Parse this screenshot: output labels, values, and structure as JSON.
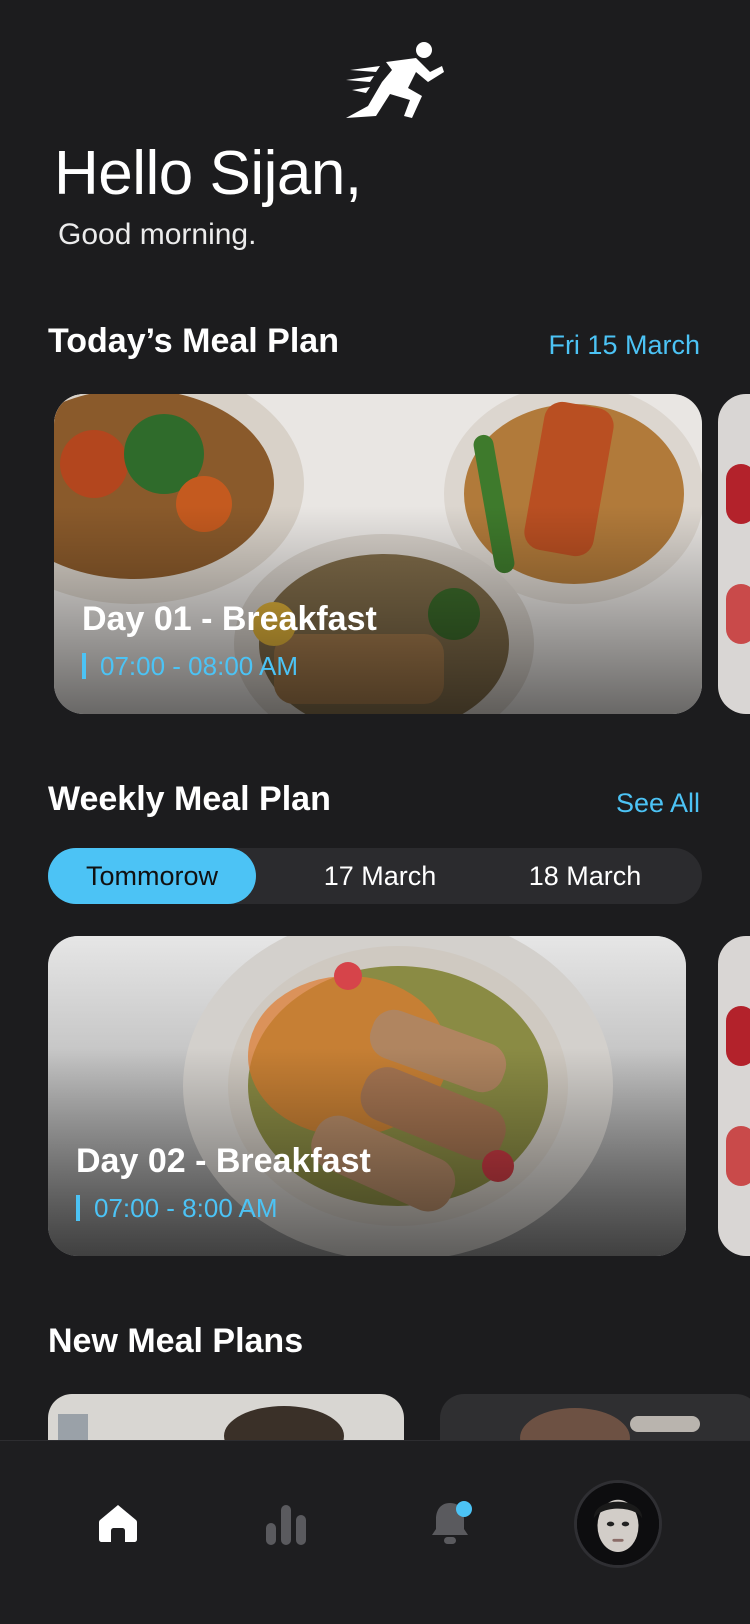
{
  "app": {
    "logo_icon": "running-man-icon"
  },
  "header": {
    "greeting": "Hello Sijan,",
    "subgreeting": "Good morning."
  },
  "today": {
    "title": "Today’s Meal Plan",
    "date": "Fri 15 March",
    "cards": [
      {
        "title": "Day 01 - Breakfast",
        "time": "07:00 - 08:00 AM"
      }
    ]
  },
  "weekly": {
    "title": "Weekly Meal Plan",
    "link": "See All",
    "tabs": [
      {
        "label": "Tommorow",
        "active": true
      },
      {
        "label": "17 March",
        "active": false
      },
      {
        "label": "18 March",
        "active": false
      }
    ],
    "cards": [
      {
        "title": "Day 02 - Breakfast",
        "time": "07:00 - 8:00 AM"
      }
    ]
  },
  "new_plans": {
    "title": "New Meal Plans"
  },
  "nav": {
    "items": [
      {
        "icon": "home-icon",
        "active": true
      },
      {
        "icon": "stats-icon",
        "active": false
      },
      {
        "icon": "notification-bell-icon",
        "active": false,
        "badge": true
      },
      {
        "icon": "profile-avatar",
        "active": false
      }
    ]
  },
  "colors": {
    "background": "#1c1c1e",
    "accent": "#4cc3f5",
    "text": "#ffffff"
  }
}
